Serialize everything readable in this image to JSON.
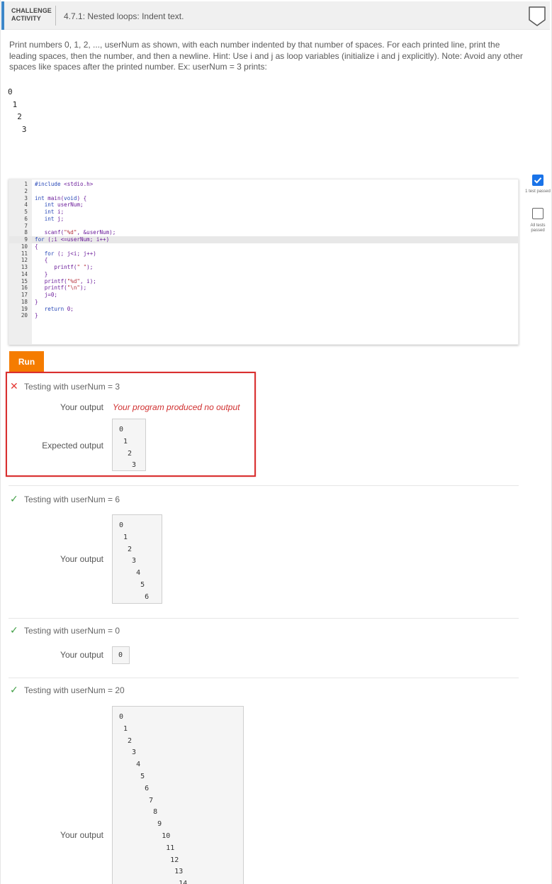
{
  "header": {
    "tag_line1": "CHALLENGE",
    "tag_line2": "ACTIVITY",
    "title": "4.7.1: Nested loops: Indent text."
  },
  "prompt": "Print numbers 0, 1, 2, ..., userNum as shown, with each number indented by that number of spaces. For each printed line, print the leading spaces, then the number, and then a newline. Hint: Use i and j as loop variables (initialize i and j explicitly). Note: Avoid any other spaces like spaces after the printed number. Ex: userNum = 3 prints:",
  "example_output": "0\n 1\n  2\n   3",
  "editor": {
    "active_line": 9,
    "lines": [
      "#include <stdio.h>",
      "",
      "int main(void) {",
      "   int userNum;",
      "   int i;",
      "   int j;",
      "",
      "   scanf(\"%d\", &userNum);",
      "for (;i <=userNum; i++)",
      "{",
      "   for (; j<i; j++)",
      "   {",
      "      printf(\" \");",
      "   }",
      "   printf(\"%d\", i);",
      "   printf(\"\\n\");",
      "   j=0;",
      "}",
      "   return 0;",
      "}"
    ]
  },
  "side": {
    "check1_label": "1 test passed",
    "check2_label": "All tests passed"
  },
  "run_label": "Run",
  "tests": {
    "t1": {
      "title": "Testing with userNum = 3",
      "your_output_label": "Your output",
      "your_output": "Your program produced no output",
      "expected_label": "Expected output",
      "expected": "0\n 1\n  2\n   3"
    },
    "t2": {
      "title": "Testing with userNum = 6",
      "your_output_label": "Your output",
      "your_output": "0\n 1\n  2\n   3\n    4\n     5\n      6"
    },
    "t3": {
      "title": "Testing with userNum = 0",
      "your_output_label": "Your output",
      "your_output": "0"
    },
    "t4": {
      "title": "Testing with userNum = 20",
      "your_output_label": "Your output",
      "your_output": "0\n 1\n  2\n   3\n    4\n     5\n      6\n       7\n        8\n         9\n          10\n           11\n            12\n             13\n              14"
    }
  },
  "colors": {
    "accent": "#3d87c9",
    "run": "#f57c00",
    "fail": "#e53935",
    "pass": "#43a047",
    "check": "#1a73e8"
  }
}
